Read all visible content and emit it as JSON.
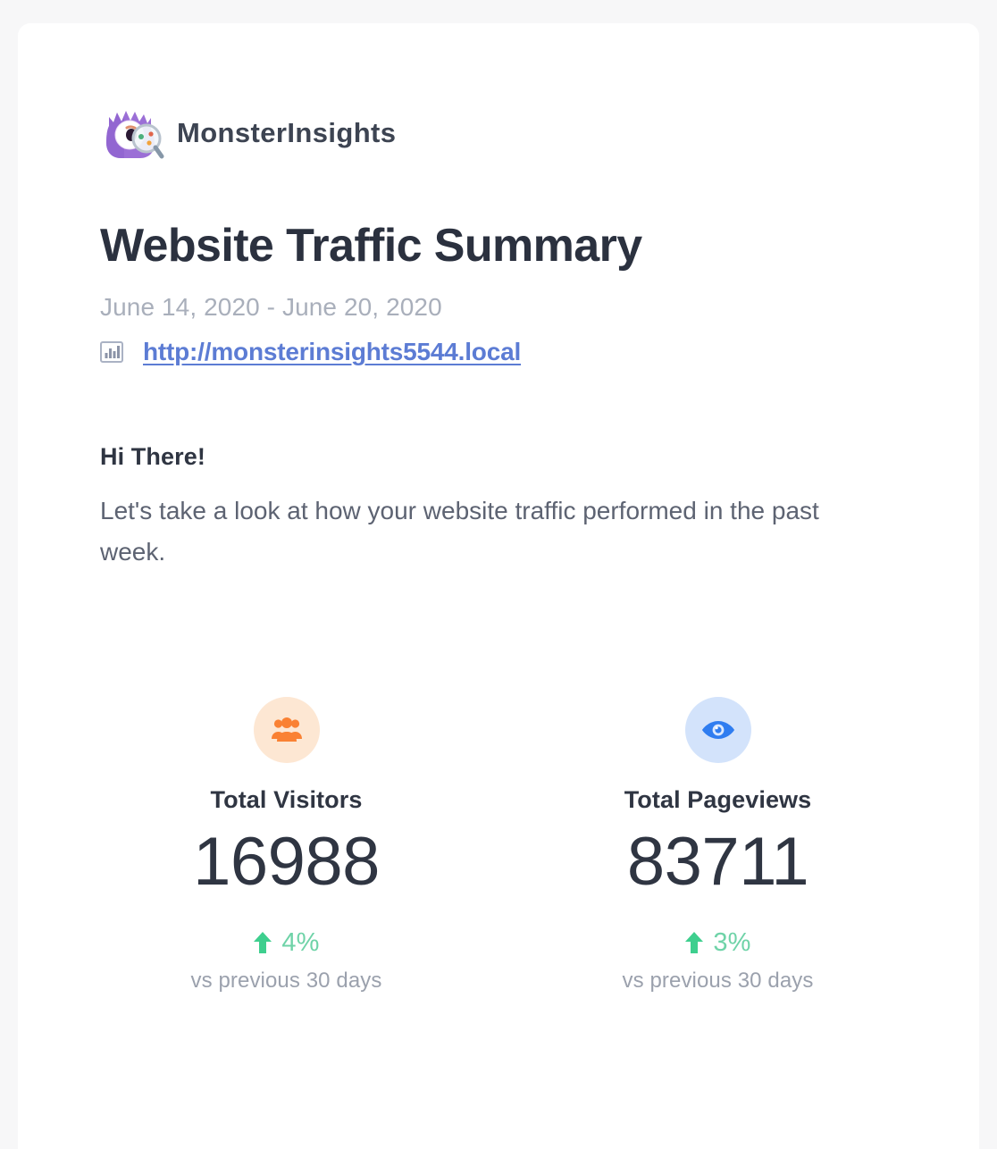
{
  "brand": {
    "name": "MonsterInsights",
    "logo_icon": "monsterinsights-monster-logo"
  },
  "header": {
    "title": "Website Traffic Summary",
    "date_range": "June 14, 2020 - June 20, 2020",
    "site_icon": "bar-chart-icon",
    "site_url": "http://monsterinsights5544.local"
  },
  "body": {
    "greeting": "Hi There!",
    "intro": "Let's take a look at how your website traffic performed in the past week."
  },
  "stats": [
    {
      "key": "total_visitors",
      "icon": "users-group-icon",
      "label": "Total Visitors",
      "value": "16988",
      "delta_direction": "up",
      "delta_arrow_icon": "arrow-up-icon",
      "delta": "4%",
      "compare": "vs previous 30 days"
    },
    {
      "key": "total_pageviews",
      "icon": "eye-icon",
      "label": "Total Pageviews",
      "value": "83711",
      "delta_direction": "up",
      "delta_arrow_icon": "arrow-up-icon",
      "delta": "3%",
      "compare": "vs previous 30 days"
    }
  ],
  "colors": {
    "page_background": "#f7f7f8",
    "card_background": "#ffffff",
    "title_text": "#2b313f",
    "muted_text": "#a9afbb",
    "body_text": "#5d6372",
    "link": "#5c7cd4",
    "visitors_badge": "#fde7d3",
    "visitors_icon": "#fa8133",
    "pageviews_badge": "#d3e3fb",
    "pageviews_icon": "#2f7df0",
    "delta_positive": "#3ecf8e"
  }
}
